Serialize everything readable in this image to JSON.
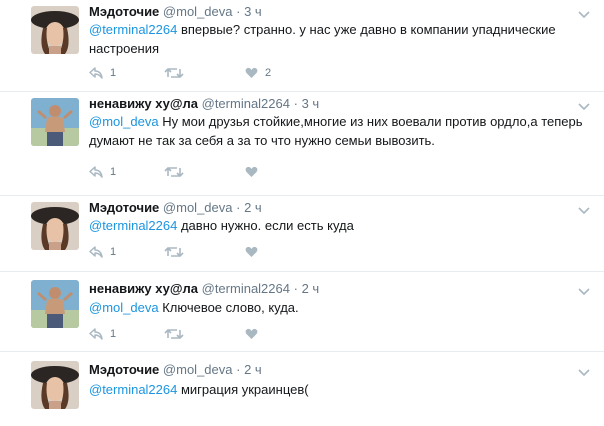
{
  "tweets": [
    {
      "author": "Мэдоточие",
      "handle": "@mol_deva",
      "dot": "·",
      "time": "3 ч",
      "mention": "@terminal2264",
      "text": " впервые? странно. у нас уже давно в компании упаднические настроения",
      "reply_count": "1",
      "retweet_count": "",
      "like_count": "2",
      "avatar": "woman-hat"
    },
    {
      "author": "ненавижу ху@ла",
      "handle": "@terminal2264",
      "dot": "·",
      "time": "3 ч",
      "mention": "@mol_deva",
      "text": " Ну мои друзья стойкие,многие из них воевали против ордло,а теперь думают не так за себя а за то что нужно семьи вывозить.",
      "reply_count": "1",
      "retweet_count": "",
      "like_count": "",
      "avatar": "man-shirtless"
    },
    {
      "author": "Мэдоточие",
      "handle": "@mol_deva",
      "dot": "·",
      "time": "2 ч",
      "mention": "@terminal2264",
      "text": " давно нужно. если есть куда",
      "reply_count": "1",
      "retweet_count": "",
      "like_count": "",
      "avatar": "woman-hat"
    },
    {
      "author": "ненавижу ху@ла",
      "handle": "@terminal2264",
      "dot": "·",
      "time": "2 ч",
      "mention": "@mol_deva",
      "text": " Ключевое слово, куда.",
      "reply_count": "1",
      "retweet_count": "",
      "like_count": "",
      "avatar": "man-shirtless"
    },
    {
      "author": "Мэдоточие",
      "handle": "@mol_deva",
      "dot": "·",
      "time": "2 ч",
      "mention": "@terminal2264",
      "text": " миграция украинцев(",
      "reply_count": "",
      "retweet_count": "",
      "like_count": "",
      "avatar": "woman-hat"
    }
  ],
  "colors": {
    "mention": "#1b95e0",
    "meta": "#657786",
    "icon": "#aab8c2",
    "divider": "#e6ecf0"
  }
}
